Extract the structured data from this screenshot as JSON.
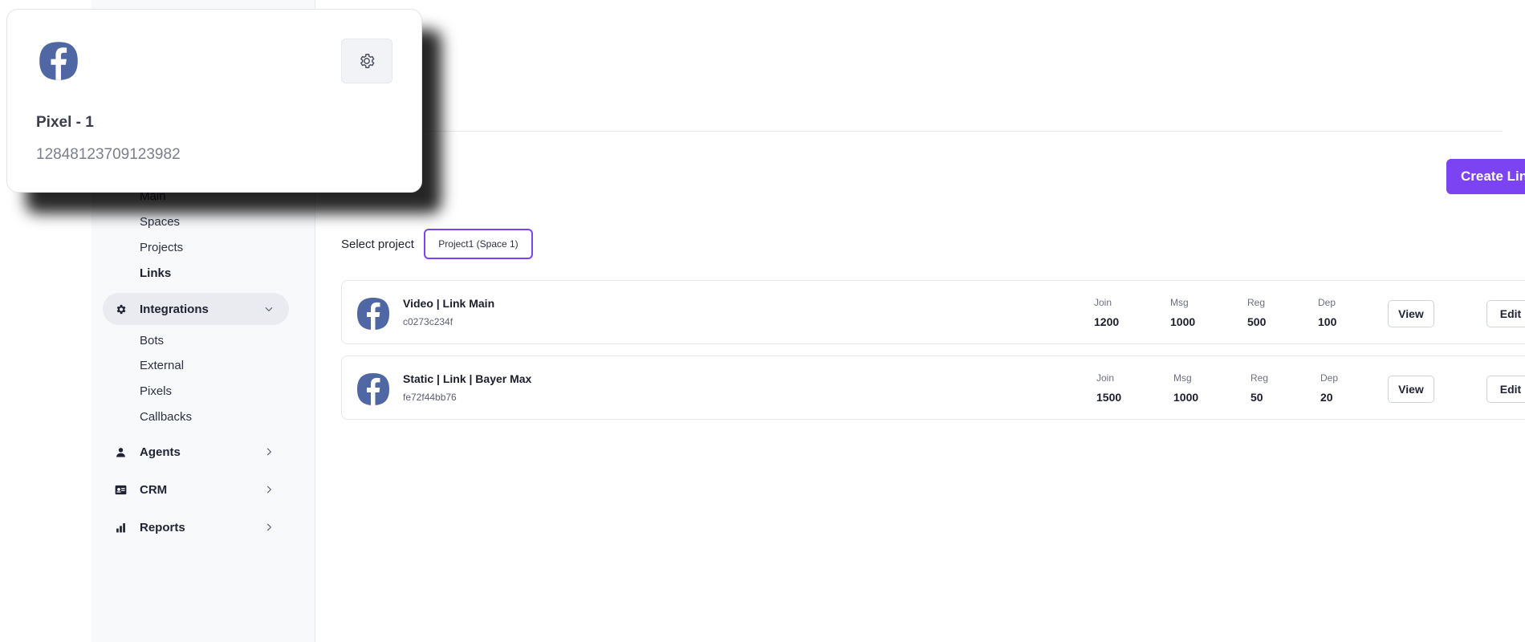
{
  "sidebar": {
    "main_items": [
      {
        "label": "Main",
        "active": false
      },
      {
        "label": "Spaces",
        "active": false
      },
      {
        "label": "Projects",
        "active": false
      },
      {
        "label": "Links",
        "active": true
      }
    ],
    "integrations": {
      "label": "Integrations",
      "icon": "gear-icon",
      "expanded": true,
      "items": [
        "Bots",
        "External",
        "Pixels",
        "Callbacks"
      ]
    },
    "sections": [
      {
        "label": "Agents",
        "icon": "person-icon"
      },
      {
        "label": "CRM",
        "icon": "id-card-icon"
      },
      {
        "label": "Reports",
        "icon": "bar-chart-icon"
      }
    ]
  },
  "main": {
    "create_button": "Create Link",
    "select_label": "Select project",
    "selected_project": "Project1 (Space 1)",
    "metric_labels": {
      "join": "Join",
      "msg": "Msg",
      "reg": "Reg",
      "dep": "Dep"
    },
    "view_label": "View",
    "edit_label": "Edit",
    "links": [
      {
        "name": "Video | Link Main",
        "code": "c0273c234f",
        "join": "1200",
        "msg": "1000",
        "reg": "500",
        "dep": "100",
        "icon": "facebook-icon"
      },
      {
        "name": "Static | Link | Bayer Max",
        "code": "fe72f44bb76",
        "join": "1500",
        "msg": "1000",
        "reg": "50",
        "dep": "20",
        "icon": "facebook-icon"
      }
    ]
  },
  "popup": {
    "title": "Pixel - 1",
    "pixel_id": "12848123709123982",
    "icon": "facebook-icon"
  },
  "colors": {
    "accent": "#7b43f2",
    "facebook": "#4f68a3",
    "sidebar_bg": "#f8f9fb"
  }
}
